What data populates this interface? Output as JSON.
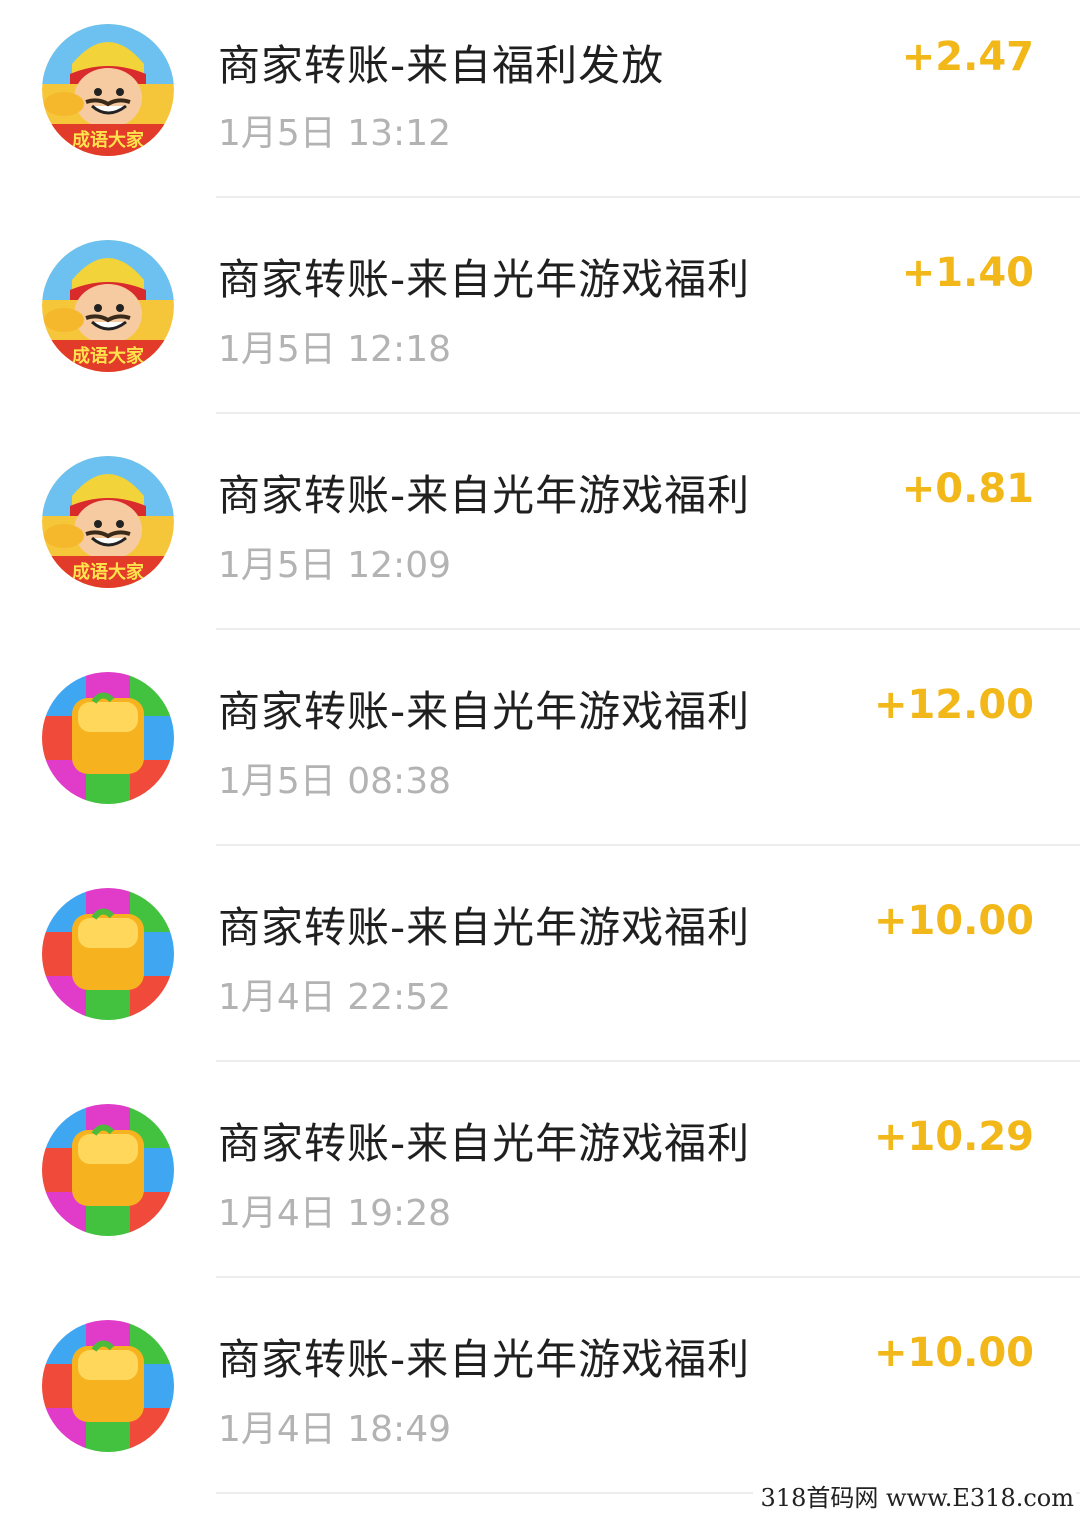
{
  "transactions": [
    {
      "title": "商家转账-来自福利发放",
      "time": "1月5日 13:12",
      "amount": "+2.47",
      "icon": "idiom-game-avatar-icon"
    },
    {
      "title": "商家转账-来自光年游戏福利",
      "time": "1月5日 12:18",
      "amount": "+1.40",
      "icon": "idiom-game-avatar-icon"
    },
    {
      "title": "商家转账-来自光年游戏福利",
      "time": "1月5日 12:09",
      "amount": "+0.81",
      "icon": "idiom-game-avatar-icon"
    },
    {
      "title": "商家转账-来自光年游戏福利",
      "time": "1月5日 08:38",
      "amount": "+12.00",
      "icon": "fruit-block-game-icon"
    },
    {
      "title": "商家转账-来自光年游戏福利",
      "time": "1月4日 22:52",
      "amount": "+10.00",
      "icon": "fruit-block-game-icon"
    },
    {
      "title": "商家转账-来自光年游戏福利",
      "time": "1月4日 19:28",
      "amount": "+10.29",
      "icon": "fruit-block-game-icon"
    },
    {
      "title": "商家转账-来自光年游戏福利",
      "time": "1月4日 18:49",
      "amount": "+10.00",
      "icon": "fruit-block-game-icon"
    }
  ],
  "avatar_text": "成语大家",
  "colors": {
    "amount": "#f2b718",
    "title": "#1f1f1f",
    "time": "#b3b3b3",
    "divider": "#ececec"
  },
  "watermark": "318首码网 www.E318.com"
}
